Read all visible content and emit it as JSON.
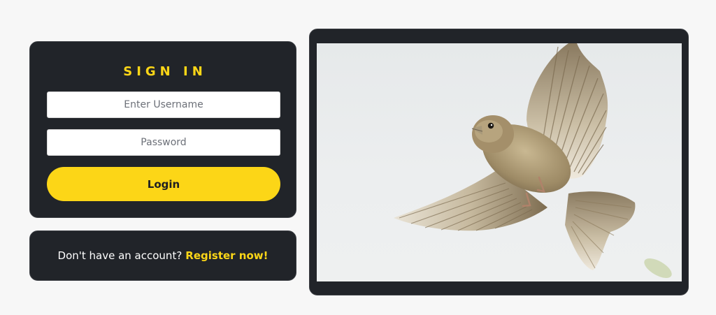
{
  "signin": {
    "title": "SIGN IN",
    "username_placeholder": "Enter Username",
    "password_placeholder": "Password",
    "login_label": "Login"
  },
  "register": {
    "prompt": "Don't have an account?",
    "link_label": "Register now!"
  },
  "theme": {
    "accent": "#fcd617",
    "card_background": "#212429",
    "page_background": "#f7f7f7"
  },
  "photo": {
    "subject": "sparrow-in-flight"
  }
}
